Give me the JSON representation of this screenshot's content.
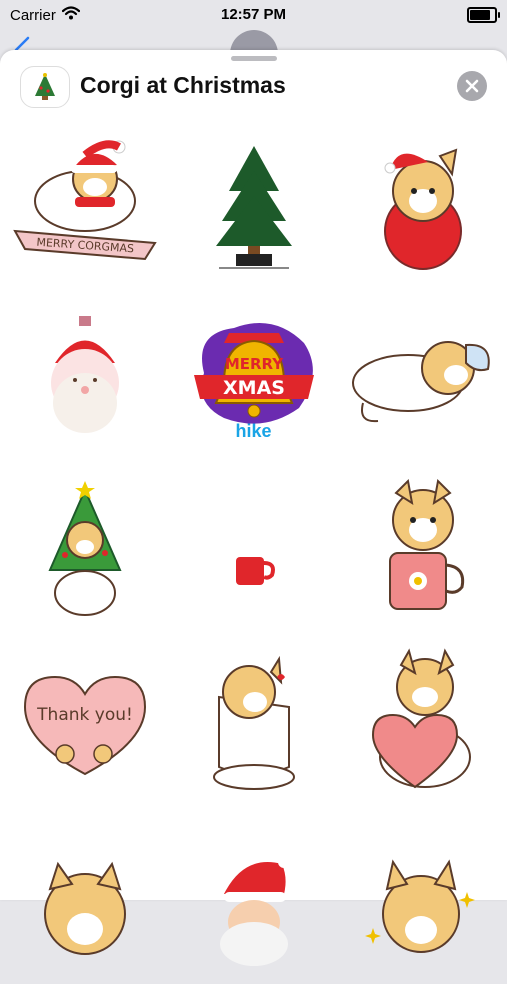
{
  "status_bar": {
    "carrier": "Carrier",
    "time": "12:57 PM"
  },
  "header": {
    "title": "Corgi at Christmas"
  },
  "stickers": {
    "merry_corgmas_text": "MERRY CORGMAS",
    "merry_text": "MERRY",
    "xmas_text": "XMAS",
    "hike_text": "hike",
    "thank_you_text": "Thank you!"
  },
  "colors": {
    "red": "#e0262b",
    "corgi_tan": "#f2c87a",
    "tree_green": "#1d5a2a",
    "heart_pink": "#f6b9b9"
  }
}
